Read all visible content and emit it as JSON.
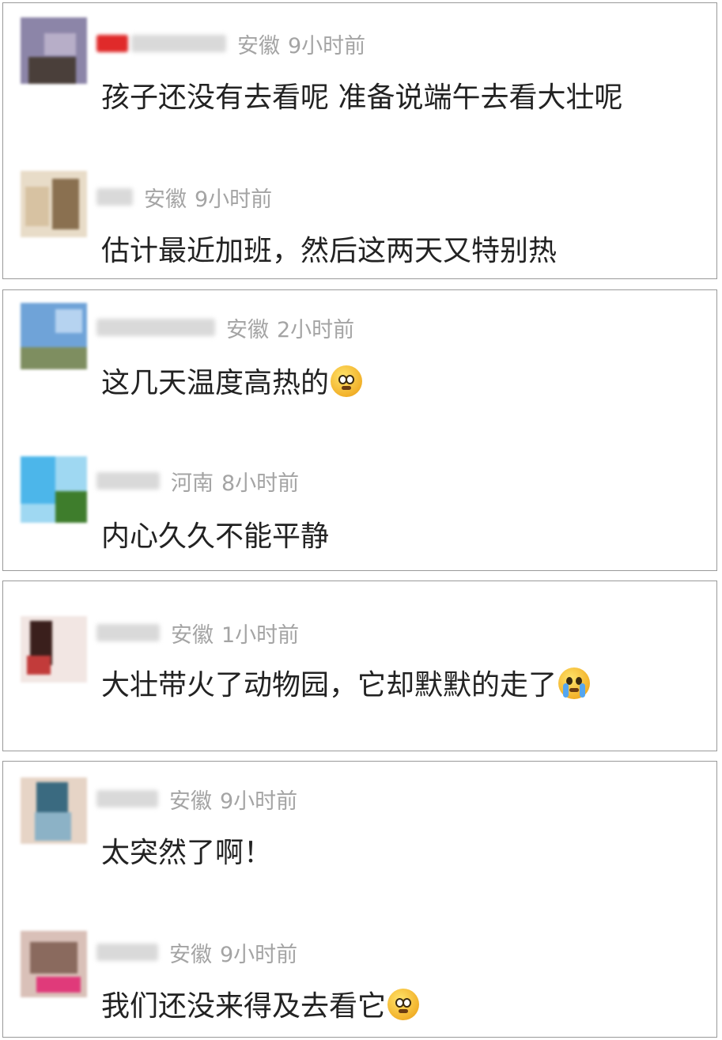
{
  "cards": [
    {
      "comments": [
        {
          "region": "安徽",
          "time": "9小时前",
          "text": "孩子还没有去看呢 准备说端午去看大壮呢",
          "emoji": ""
        },
        {
          "region": "安徽",
          "time": "9小时前",
          "text": "估计最近加班，然后这两天又特别热",
          "emoji": ""
        }
      ]
    },
    {
      "comments": [
        {
          "region": "安徽",
          "time": "2小时前",
          "text": "这几天温度高热的",
          "emoji": "pleading-face-icon"
        },
        {
          "region": "河南",
          "time": "8小时前",
          "text": "内心久久不能平静",
          "emoji": ""
        }
      ]
    },
    {
      "comments": [
        {
          "region": "安徽",
          "time": "1小时前",
          "text": "大壮带火了动物园，它却默默的走了",
          "emoji": "crying-face-icon"
        }
      ]
    },
    {
      "comments": [
        {
          "region": "安徽",
          "time": "9小时前",
          "text": "太突然了啊！",
          "emoji": ""
        },
        {
          "region": "安徽",
          "time": "9小时前",
          "text": "我们还没来得及去看它",
          "emoji": "sad-face-icon"
        }
      ]
    }
  ]
}
